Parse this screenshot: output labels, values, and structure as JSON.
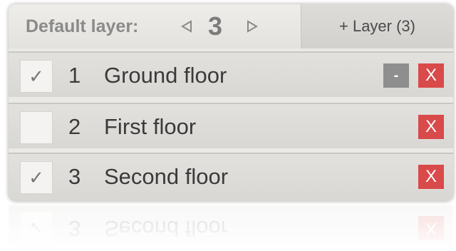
{
  "header": {
    "default_layer_label": "Default layer:",
    "current_layer": "3",
    "prev_icon": "triangle-left-icon",
    "next_icon": "triangle-right-icon",
    "add_layer_label": "+ Layer (3)"
  },
  "layers": [
    {
      "number": "1",
      "name": "Ground floor",
      "checked": true,
      "check_mark": "✓",
      "has_minus": true,
      "minus_label": "-",
      "delete_label": "X"
    },
    {
      "number": "2",
      "name": "First floor",
      "checked": false,
      "check_mark": "",
      "has_minus": false,
      "delete_label": "X"
    },
    {
      "number": "3",
      "name": "Second floor",
      "checked": true,
      "check_mark": "✓",
      "has_minus": false,
      "delete_label": "X"
    }
  ],
  "colors": {
    "delete_red": "#d94a4a",
    "minus_grey": "#8e8e8e",
    "panel_bg": "#ebe9e6"
  }
}
